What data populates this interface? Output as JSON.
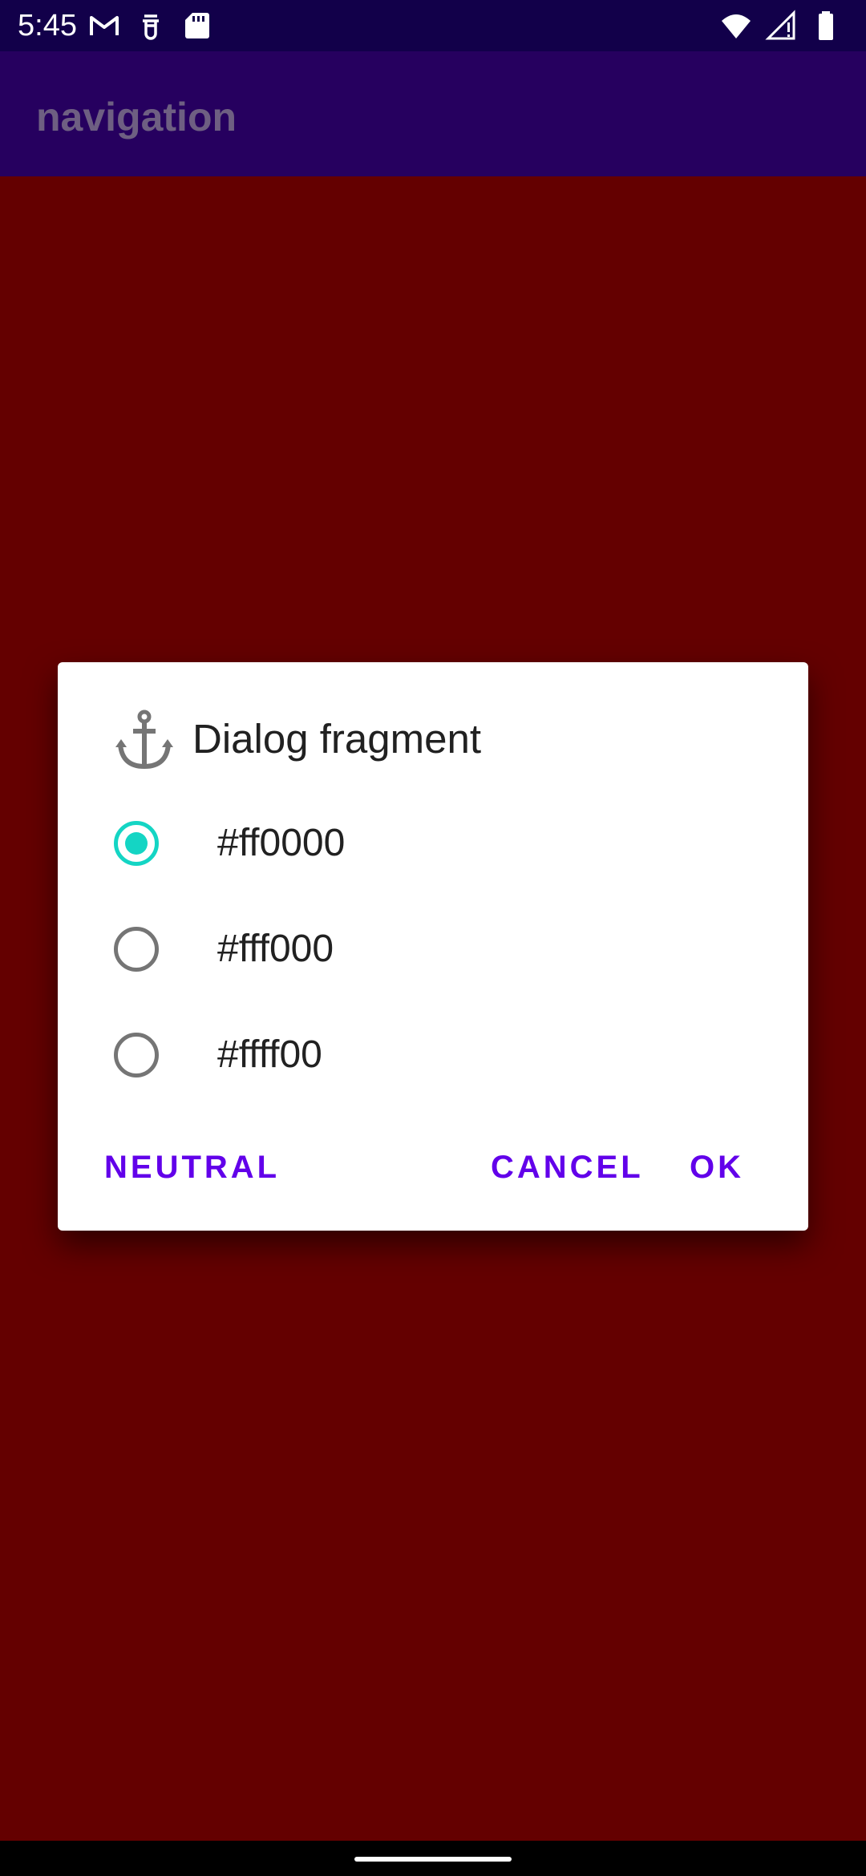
{
  "status_bar": {
    "time": "5:45",
    "left_icons": [
      "gmail-icon",
      "notification-icon",
      "sd-card-icon"
    ],
    "right_icons": [
      "wifi-icon",
      "signal-icon",
      "battery-icon"
    ]
  },
  "app_bar": {
    "title": "navigation"
  },
  "colors": {
    "background": "#640000",
    "app_bar": "#26005f",
    "status_bar": "#12004a",
    "accent": "#14d5c4",
    "button_text": "#6200ea"
  },
  "dialog": {
    "icon": "anchor-icon",
    "title": "Dialog fragment",
    "options": [
      {
        "label": "#ff0000",
        "checked": true
      },
      {
        "label": "#fff000",
        "checked": false
      },
      {
        "label": "#ffff00",
        "checked": false
      }
    ],
    "buttons": {
      "neutral": "NEUTRAL",
      "cancel": "CANCEL",
      "ok": "OK"
    }
  }
}
